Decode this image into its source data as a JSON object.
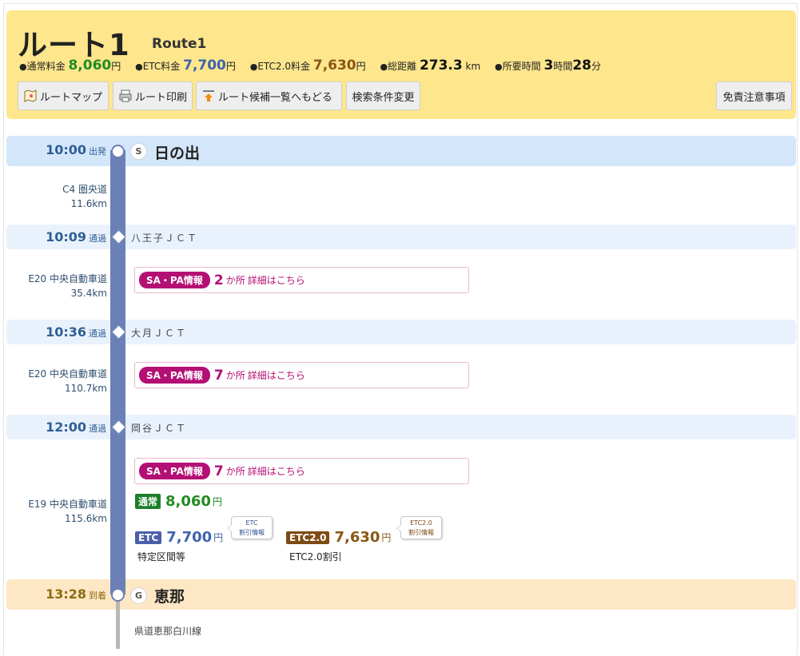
{
  "header": {
    "title": "ルート1",
    "subtitle": "Route1",
    "summary": [
      {
        "label": "通常料金",
        "value": "8,060",
        "unit": "円",
        "color": "#228b22"
      },
      {
        "label": "ETC料金",
        "value": "7,700",
        "unit": "円",
        "color": "#3d63ae"
      },
      {
        "label": "ETC2.0料金",
        "value": "7,630",
        "unit": "円",
        "color": "#8a5715"
      },
      {
        "label": "総距離",
        "value": "273.3",
        "unit": "km",
        "color": "#111111"
      }
    ],
    "duration": {
      "label": "所要時間",
      "hours": "3",
      "hours_unit": "時間",
      "minutes": "28",
      "minutes_unit": "分"
    },
    "buttons": {
      "route_map": "ルートマップ",
      "route_print": "ルート印刷",
      "back_to_list": "ルート候補一覧へもどる",
      "change_conditions": "検索条件変更",
      "disclaimer": "免責注意事項"
    }
  },
  "start": {
    "time": "10:00",
    "label": "出発",
    "badge": "S",
    "place": "日の出"
  },
  "segments": [
    {
      "road": "C4 圏央道",
      "distance": "11.6km"
    },
    {
      "road": "E20 中央自動車道",
      "distance": "35.4km",
      "sa_label": "SA・PA情報",
      "sa_count": "2",
      "sa_unit": "か所",
      "sa_link": "詳細はこちら"
    },
    {
      "road": "E20 中央自動車道",
      "distance": "110.7km",
      "sa_label": "SA・PA情報",
      "sa_count": "7",
      "sa_unit": "か所",
      "sa_link": "詳細はこちら"
    },
    {
      "road": "E19 中央自動車道",
      "distance": "115.6km",
      "sa_label": "SA・PA情報",
      "sa_count": "7",
      "sa_unit": "か所",
      "sa_link": "詳細はこちら"
    }
  ],
  "passes": [
    {
      "time": "10:09",
      "label": "通過",
      "name": "八王子ＪＣＴ"
    },
    {
      "time": "10:36",
      "label": "通過",
      "name": "大月ＪＣＴ"
    },
    {
      "time": "12:00",
      "label": "通過",
      "name": "岡谷ＪＣＴ"
    }
  ],
  "fees": {
    "normal": {
      "tag": "通常",
      "value": "8,060",
      "unit": "円",
      "color": "#228b22"
    },
    "etc": {
      "tag": "ETC",
      "value": "7,700",
      "unit": "円",
      "color": "#4a5fab",
      "bubble_top": "ETC",
      "bubble_bottom": "割引情報",
      "note": "特定区間等"
    },
    "etc2": {
      "tag": "ETC2.0",
      "value": "7,630",
      "unit": "円",
      "color": "#8a5715",
      "bubble_top": "ETC2.0",
      "bubble_bottom": "割引情報",
      "note": "ETC2.0割引"
    }
  },
  "goal": {
    "time": "13:28",
    "label": "到着",
    "badge": "G",
    "place": "恵那",
    "after_road": "県道恵那白川線"
  }
}
